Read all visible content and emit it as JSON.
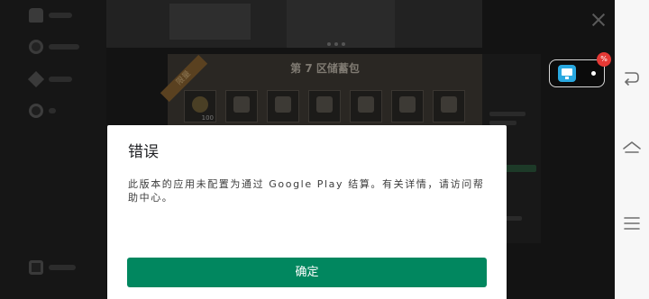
{
  "game": {
    "card_title": "第 7 区储蓄包",
    "ribbon": "限量",
    "first_item_count": "100"
  },
  "floating_widget": {
    "badge": "%",
    "icons": [
      "monitor-icon",
      "dot-icon"
    ]
  },
  "dialog": {
    "title": "错误",
    "message": "此版本的应用未配置为通过 Google Play 结算。有关详情，请访问帮助中心。",
    "confirm_label": "确定"
  },
  "navbar": {
    "icons": [
      "back-icon",
      "home-icon",
      "menu-icon"
    ]
  },
  "colors": {
    "accent": "#01875f",
    "dialog_bg": "#ffffff",
    "badge": "#e53935",
    "widget_icon": "#29a8e0",
    "navbar_bg": "#f7f7f7"
  }
}
